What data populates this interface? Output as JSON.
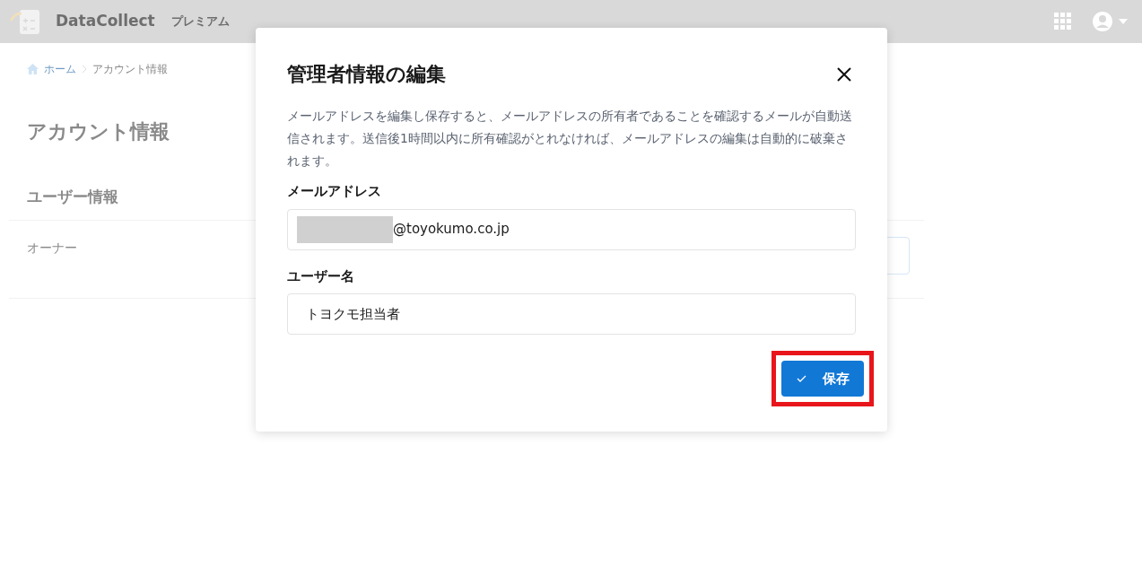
{
  "header": {
    "app_name": "DataCollect",
    "plan": "プレミアム"
  },
  "breadcrumb": [
    "ホーム",
    "アカウント情報"
  ],
  "page_title": "アカウント情報",
  "section_title": "ユーザー情報",
  "row_label": "オーナー",
  "dialog": {
    "title": "管理者情報の編集",
    "description": "メールアドレスを編集し保存すると、メールアドレスの所有者であることを確認するメールが自動送信されます。送信後1時間以内に所有確認がとれなければ、メールアドレスの編集は自動的に破棄されます。",
    "fields": [
      {
        "label": "メールアドレス",
        "value": "@toyokumo.co.jp",
        "redacted": true
      },
      {
        "label": "ユーザー名",
        "value": "トヨクモ担当者",
        "redacted": false
      }
    ],
    "save_button": {
      "label": "保存",
      "highlighted": true
    }
  }
}
